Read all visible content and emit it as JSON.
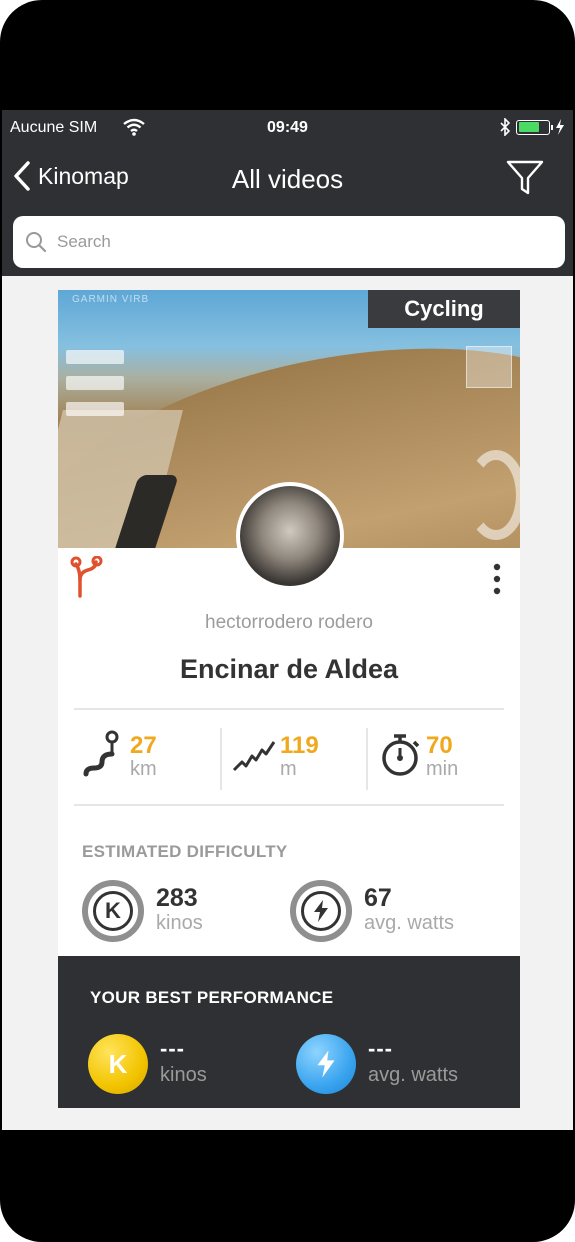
{
  "status_bar": {
    "carrier": "Aucune SIM",
    "time": "09:49",
    "battery_color": "#4cd964"
  },
  "nav": {
    "back_label": "Kinomap",
    "title": "All videos"
  },
  "search": {
    "placeholder": "Search"
  },
  "video": {
    "thumbnail_watermark": "GARMIN VIRB",
    "activity": "Cycling",
    "author": "hectorrodero rodero",
    "title": "Encinar de Aldea",
    "stats": [
      {
        "icon": "distance-icon",
        "value": "27",
        "unit": "km"
      },
      {
        "icon": "elevation-icon",
        "value": "119",
        "unit": "m"
      },
      {
        "icon": "stopwatch-icon",
        "value": "70",
        "unit": "min"
      }
    ],
    "difficulty": {
      "heading": "ESTIMATED DIFFICULTY",
      "kinos_value": "283",
      "kinos_unit": "kinos",
      "kinos_letter": "K",
      "watts_value": "67",
      "watts_unit": "avg. watts"
    },
    "best_performance": {
      "heading": "YOUR BEST PERFORMANCE",
      "kinos_value": "---",
      "kinos_unit": "kinos",
      "kinos_letter": "K",
      "watts_value": "---",
      "watts_unit": "avg. watts"
    }
  },
  "colors": {
    "accent": "#f0a81d",
    "route_icon": "#e0522e",
    "bar": "#2f3033"
  }
}
